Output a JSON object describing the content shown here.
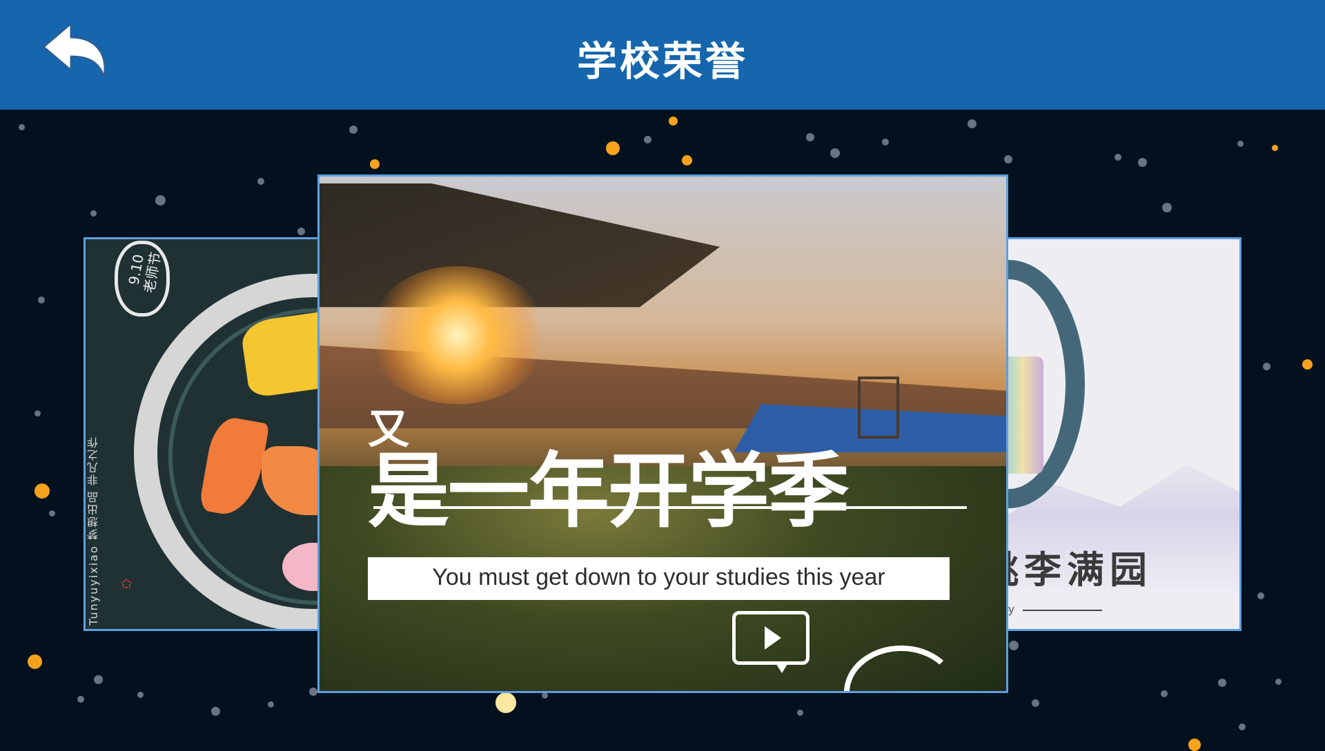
{
  "header": {
    "title": "学校荣誉",
    "back_icon": "back-arrow-icon",
    "background": "#1566ad"
  },
  "carousel": {
    "left_card": {
      "bubble_text": "9.10 老师节",
      "vertical_text": "Tunyuyixiao 梦想出品 非凡之作"
    },
    "center_card": {
      "headline_small": "又",
      "headline_main": "是一年开学季",
      "subtitle": "You must get down to your studies this year",
      "play_icon": "play-icon"
    },
    "right_card": {
      "title": "桃李满园",
      "subtitle": "s day"
    }
  },
  "colors": {
    "accent_dot": "#f7a21d",
    "card_border": "#5f9fe0",
    "background": "#03111f"
  }
}
